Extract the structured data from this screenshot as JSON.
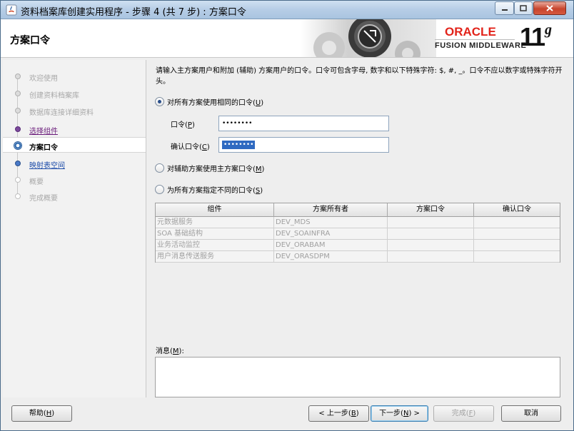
{
  "window": {
    "title": "资料档案库创建实用程序 - 步骤 4 (共 7 步) : 方案口令"
  },
  "header": {
    "page_title": "方案口令",
    "logo_oracle": "ORACLE",
    "logo_fusion": "FUSION MIDDLEWARE",
    "logo_version": "11",
    "logo_version_suffix": "g"
  },
  "nav": {
    "items": [
      {
        "label": "欢迎使用",
        "state": "done"
      },
      {
        "label": "创建资料档案库",
        "state": "done"
      },
      {
        "label": "数据库连接详细资料",
        "state": "done"
      },
      {
        "label": "选择组件",
        "state": "visited"
      },
      {
        "label": "方案口令",
        "state": "current"
      },
      {
        "label": "映射表空间",
        "state": "link"
      },
      {
        "label": "概要",
        "state": "future"
      },
      {
        "label": "完成概要",
        "state": "future"
      }
    ]
  },
  "main": {
    "description": "请输入主方案用户和附加 (辅助) 方案用户的口令。口令可包含字母, 数字和以下特殊字符: $, #, _。口令不应以数字或特殊字符开头。",
    "radio_same": {
      "text": "对所有方案使用相同的口令(",
      "mnemonic": "U",
      "suffix": ")",
      "checked": true
    },
    "password_label": {
      "text": "口令(",
      "mnemonic": "P",
      "suffix": ")"
    },
    "password_value": "••••••••",
    "confirm_label": {
      "text": "确认口令(",
      "mnemonic": "C",
      "suffix": ")"
    },
    "confirm_value": "••••••••",
    "radio_aux": {
      "text": "对辅助方案使用主方案口令(",
      "mnemonic": "M",
      "suffix": ")",
      "checked": false
    },
    "radio_diff": {
      "text": "为所有方案指定不同的口令(",
      "mnemonic": "S",
      "suffix": ")",
      "checked": false
    },
    "table": {
      "headers": [
        "组件",
        "方案所有者",
        "方案口令",
        "确认口令"
      ],
      "rows": [
        [
          "元数据服务",
          "DEV_MDS",
          "",
          ""
        ],
        [
          "SOA 基础结构",
          "DEV_SOAINFRA",
          "",
          ""
        ],
        [
          "业务活动监控",
          "DEV_ORABAM",
          "",
          ""
        ],
        [
          "用户消息传送服务",
          "DEV_ORASDPM",
          "",
          ""
        ]
      ]
    },
    "messages_label": {
      "text": "消息(",
      "mnemonic": "M",
      "suffix": "):"
    }
  },
  "footer": {
    "help": {
      "text": "帮助(",
      "mnemonic": "H",
      "suffix": ")"
    },
    "back": {
      "text": "< 上一步(",
      "mnemonic": "B",
      "suffix": ")"
    },
    "next": {
      "text": "下一步(",
      "mnemonic": "N",
      "suffix": ") >"
    },
    "finish": {
      "text": "完成(",
      "mnemonic": "F",
      "suffix": ")"
    },
    "cancel": "取消"
  },
  "colors": {
    "oracle_red": "#e2231a",
    "selection_blue": "#2f6ac1",
    "link_blue": "#1a4aa8",
    "visited_purple": "#6a1b7a"
  }
}
